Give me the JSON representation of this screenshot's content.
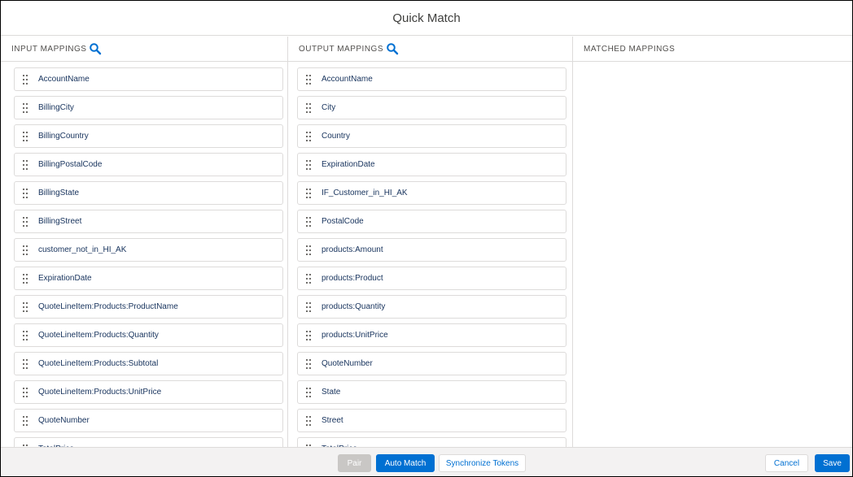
{
  "modal": {
    "title": "Quick Match"
  },
  "input_mappings": {
    "header": "INPUT MAPPINGS",
    "icon": "search-icon",
    "items": [
      "AccountName",
      "BillingCity",
      "BillingCountry",
      "BillingPostalCode",
      "BillingState",
      "BillingStreet",
      "customer_not_in_HI_AK",
      "ExpirationDate",
      "QuoteLineItem:Products:ProductName",
      "QuoteLineItem:Products:Quantity",
      "QuoteLineItem:Products:Subtotal",
      "QuoteLineItem:Products:UnitPrice",
      "QuoteNumber",
      "TotalPrice"
    ]
  },
  "output_mappings": {
    "header": "OUTPUT MAPPINGS",
    "icon": "search-icon",
    "items": [
      "AccountName",
      "City",
      "Country",
      "ExpirationDate",
      "IF_Customer_in_HI_AK",
      "PostalCode",
      "products:Amount",
      "products:Product",
      "products:Quantity",
      "products:UnitPrice",
      "QuoteNumber",
      "State",
      "Street",
      "TotalPrice"
    ]
  },
  "matched_mappings": {
    "header": "MATCHED MAPPINGS",
    "items": []
  },
  "footer": {
    "pair_label": "Pair",
    "auto_match_label": "Auto Match",
    "sync_label": "Synchronize Tokens",
    "cancel_label": "Cancel",
    "save_label": "Save"
  },
  "colors": {
    "brand": "#0070d2",
    "disabled": "#c9c7c5",
    "border": "#dddbda",
    "footer_bg": "#f3f2f2"
  }
}
